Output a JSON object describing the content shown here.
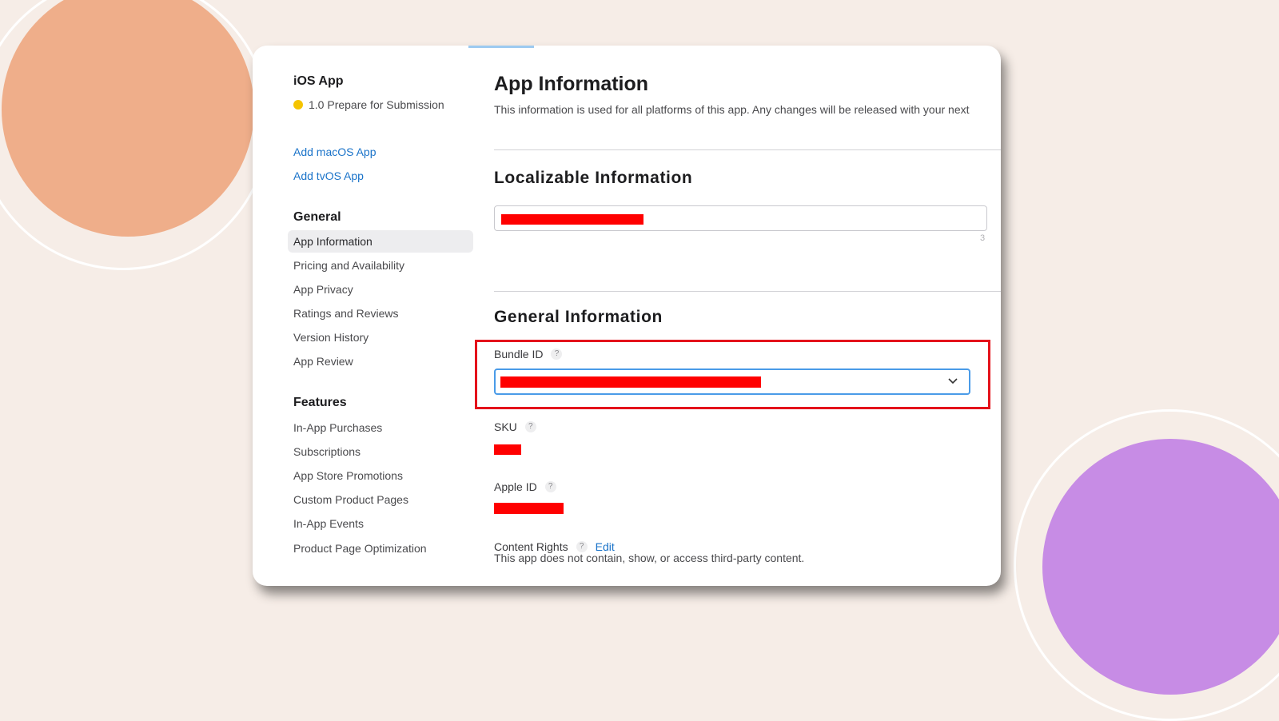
{
  "sidebar": {
    "app_title": "iOS App",
    "status": "1.0 Prepare for Submission",
    "links": [
      "Add macOS App",
      "Add tvOS App"
    ],
    "general_heading": "General",
    "general_items": [
      "App Information",
      "Pricing and Availability",
      "App Privacy",
      "Ratings and Reviews",
      "Version History",
      "App Review"
    ],
    "features_heading": "Features",
    "feature_items": [
      "In-App Purchases",
      "Subscriptions",
      "App Store Promotions",
      "Custom Product Pages",
      "In-App Events",
      "Product Page Optimization"
    ]
  },
  "main": {
    "title": "App Information",
    "description": "This information is used for all platforms of this app. Any changes will be released with your next",
    "localizable_heading": "Localizable Information",
    "char_count": "3",
    "general_heading": "General Information",
    "bundle_id_label": "Bundle ID",
    "sku_label": "SKU",
    "apple_id_label": "Apple ID",
    "content_rights_label": "Content Rights",
    "edit_label": "Edit",
    "help_glyph": "?",
    "content_rights_text": "This app does not contain, show, or access third-party content."
  },
  "colors": {
    "link": "#1a73c9",
    "status_dot": "#f5c400",
    "redaction": "#ff0000",
    "highlight": "#e4121b",
    "circle_top_left": "#efae8a",
    "circle_bottom_right": "#c78ce5"
  },
  "icons": [
    "status-dot-icon",
    "help-icon",
    "chevron-down-icon"
  ]
}
